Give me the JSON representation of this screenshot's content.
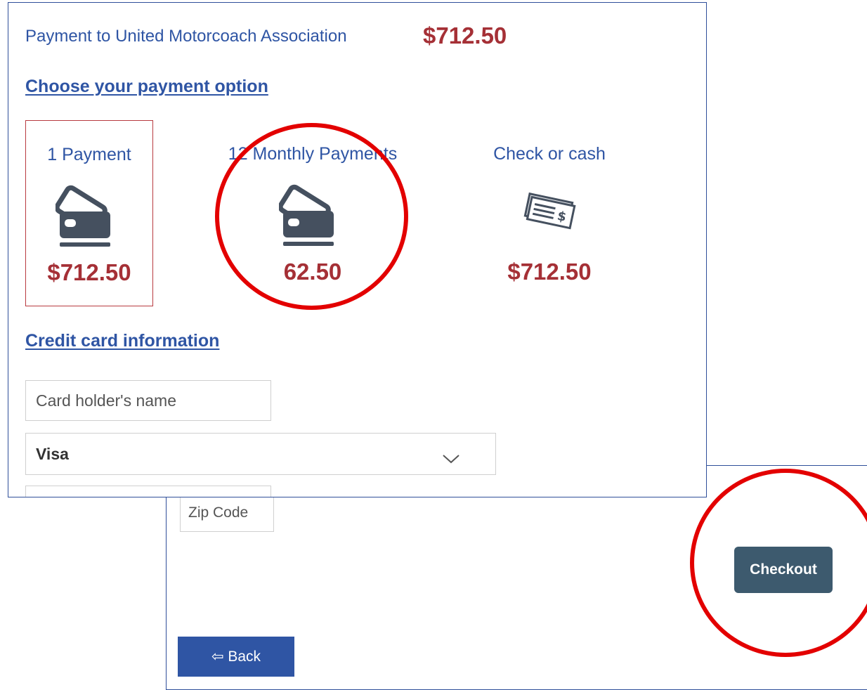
{
  "header": {
    "title": "Payment to United Motorcoach Association",
    "total": "$712.50"
  },
  "sections": {
    "payment_option": "Choose your payment option",
    "credit_card": "Credit card information"
  },
  "options": [
    {
      "label": "1 Payment",
      "amount": "$712.50",
      "icon": "credit-card-icon",
      "selected": true
    },
    {
      "label": "12 Monthly Payments",
      "amount": "62.50",
      "icon": "credit-card-icon",
      "selected": false
    },
    {
      "label": "Check or cash",
      "amount": "$712.50",
      "icon": "check-cash-icon",
      "selected": false
    }
  ],
  "form": {
    "card_holder_placeholder": "Card holder's name",
    "card_type": "Visa",
    "zip_placeholder": "Zip Code"
  },
  "buttons": {
    "checkout": "Checkout",
    "back": "⇦ Back"
  },
  "colors": {
    "accent_blue": "#2f55a4",
    "price_red": "#a53036",
    "checkout_bg": "#3d5a6e",
    "annotation_red": "#e30000"
  }
}
